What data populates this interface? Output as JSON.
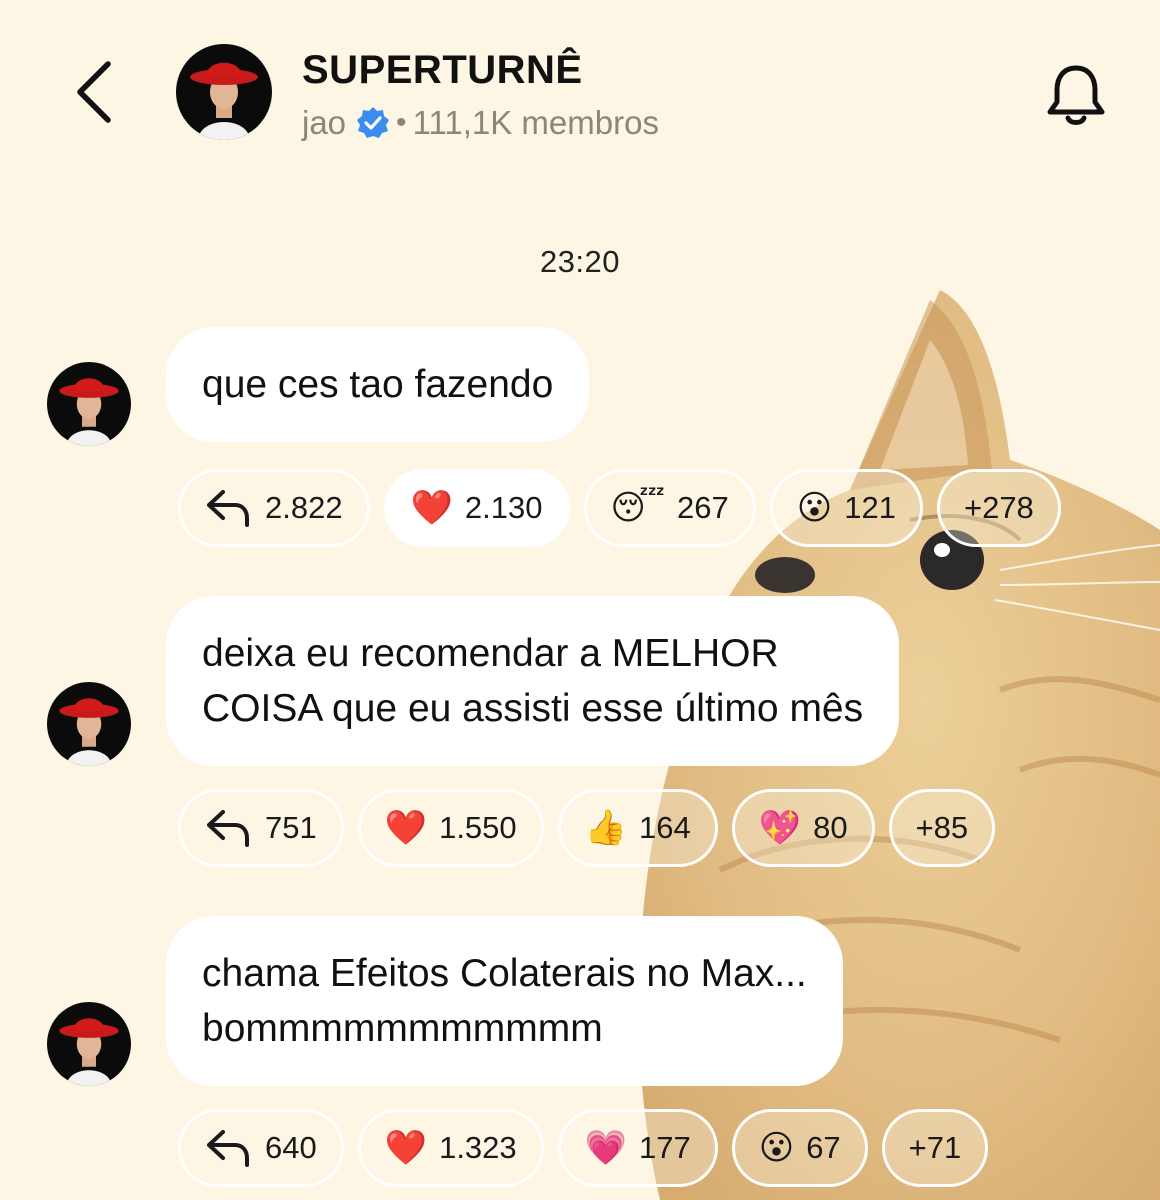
{
  "header": {
    "title": "SUPERTURNÊ",
    "owner": "jao",
    "separator": "•",
    "members": "111,1K membros"
  },
  "timestamp": "23:20",
  "messages": [
    {
      "lines": [
        "que ces tao fazendo"
      ],
      "reactions": [
        {
          "type": "reply",
          "count": "2.822"
        },
        {
          "emoji": "❤️",
          "emoji_name": "red-heart",
          "count": "2.130"
        },
        {
          "emoji": "😴",
          "emoji_name": "sleeping-face",
          "count": "267"
        },
        {
          "emoji": "😮",
          "emoji_name": "surprised-face",
          "count": "121"
        },
        {
          "more": "+278"
        }
      ]
    },
    {
      "lines": [
        "deixa eu recomendar a MELHOR",
        "COISA que eu assisti esse último mês"
      ],
      "reactions": [
        {
          "type": "reply",
          "count": "751"
        },
        {
          "emoji": "❤️",
          "emoji_name": "red-heart",
          "count": "1.550"
        },
        {
          "emoji": "👍",
          "emoji_name": "thumbs-up",
          "count": "164"
        },
        {
          "emoji": "💖",
          "emoji_name": "sparkling-heart",
          "count": "80"
        },
        {
          "more": "+85"
        }
      ]
    },
    {
      "lines": [
        "chama Efeitos Colaterais no Max...",
        "bommmmmmmmmmm"
      ],
      "reactions": [
        {
          "type": "reply",
          "count": "640"
        },
        {
          "emoji": "❤️",
          "emoji_name": "red-heart",
          "count": "1.323"
        },
        {
          "emoji": "💗",
          "emoji_name": "growing-heart",
          "count": "177"
        },
        {
          "emoji": "😮",
          "emoji_name": "surprised-face",
          "count": "67"
        },
        {
          "more": "+71"
        }
      ]
    }
  ],
  "colors": {
    "background": "#fdf6e4",
    "bubble": "#ffffff",
    "verified": "#3b8cf0",
    "subtitle": "#8a8678",
    "hat": "#d21a1a"
  },
  "icons": [
    "back-chevron-icon",
    "verified-badge-icon",
    "bell-icon",
    "reply-arrow-icon"
  ]
}
